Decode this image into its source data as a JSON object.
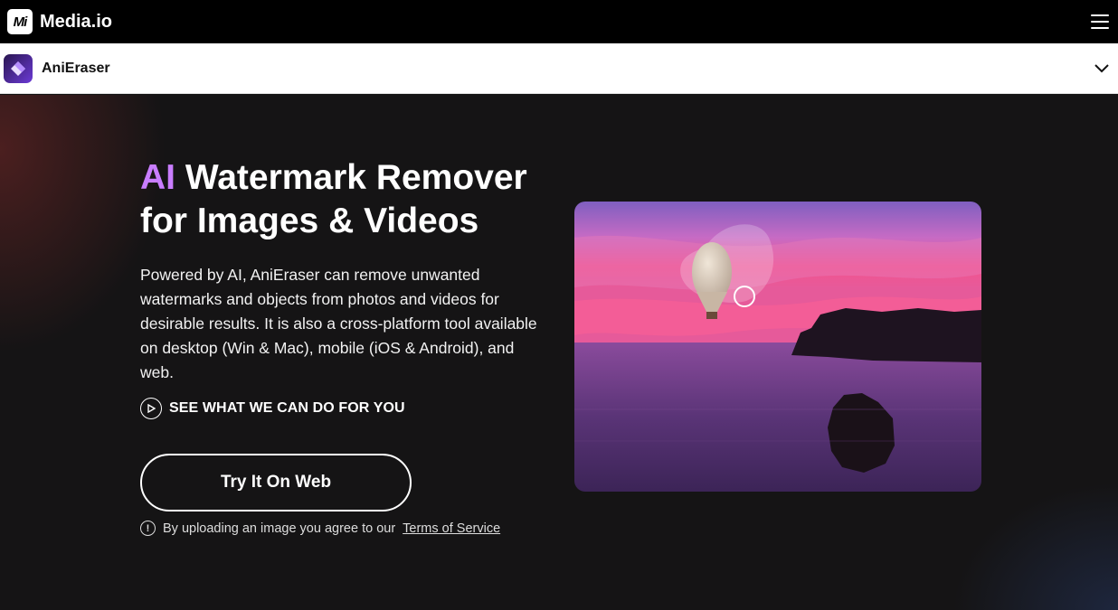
{
  "topbar": {
    "logo_text": "Mi",
    "brand": "Media.io",
    "menu_icon": "hamburger-icon"
  },
  "productbar": {
    "product_name": "AniEraser",
    "product_icon": "eraser-icon",
    "expand_icon": "chevron-down-icon"
  },
  "hero": {
    "title_accent": "AI",
    "title_rest_line1": " Watermark Remover",
    "title_line2": "for Images & Videos",
    "description": "Powered by AI, AniEraser can remove unwanted watermarks and objects from photos and videos for desirable results. It is also a cross-platform tool available on desktop (Win & Mac), mobile (iOS & Android), and web.",
    "see_link_label": "SEE WHAT WE CAN DO FOR YOU",
    "see_link_icon": "play-circle-icon",
    "cta_label": "Try It On Web",
    "terms_prefix": "By uploading an image you agree to our ",
    "terms_link": "Terms of Service",
    "terms_icon": "info-icon"
  },
  "preview": {
    "image": "hot-air-balloon-sunset-sea-image"
  },
  "colors": {
    "accent": "#c97dff",
    "topbar_bg": "#000000",
    "hero_bg": "#151415"
  }
}
